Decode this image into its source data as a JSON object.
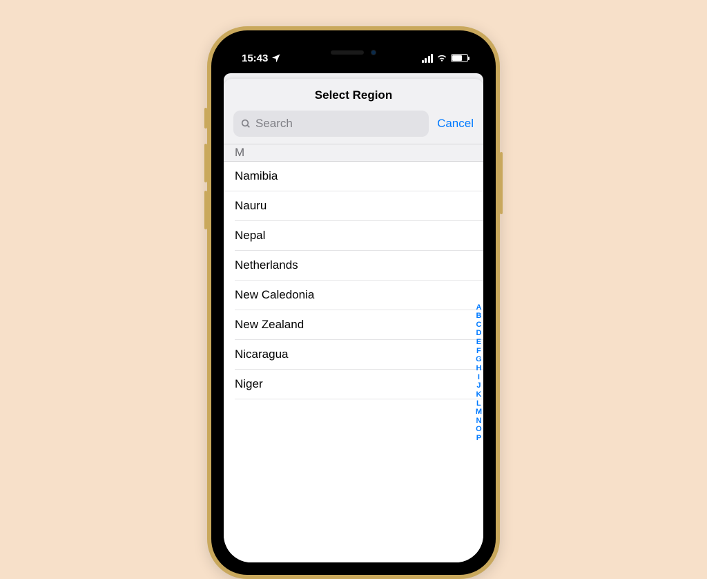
{
  "status": {
    "time": "15:43"
  },
  "sheet": {
    "title": "Select Region",
    "searchPlaceholder": "Search",
    "cancel": "Cancel",
    "sectionHeader": "M"
  },
  "list": {
    "items": [
      "Namibia",
      "Nauru",
      "Nepal",
      "Netherlands",
      "New Caledonia",
      "New Zealand",
      "Nicaragua",
      "Niger"
    ]
  },
  "indexBar": [
    "A",
    "B",
    "C",
    "D",
    "E",
    "F",
    "G",
    "H",
    "I",
    "J",
    "K",
    "L",
    "M",
    "N",
    "O",
    "P"
  ]
}
